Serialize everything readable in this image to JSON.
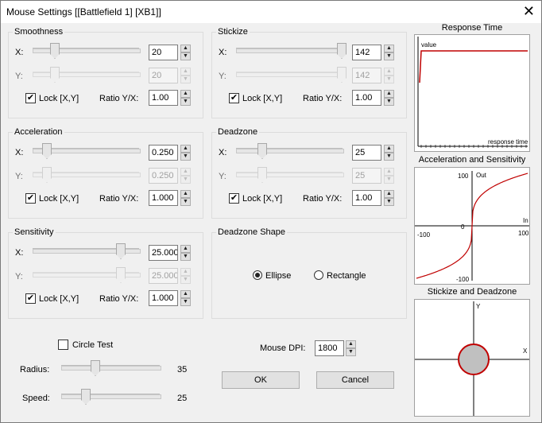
{
  "window": {
    "title": "Mouse Settings [[Battlefield 1] [XB1]]"
  },
  "smoothness": {
    "title": "Smoothness",
    "x_label": "X:",
    "y_label": "Y:",
    "x_value": "20",
    "y_value": "20",
    "lock_label": "Lock [X,Y]",
    "ratio_label": "Ratio Y/X:",
    "ratio_value": "1.00",
    "x_level": 0.25,
    "y_level": 0.25
  },
  "stickize": {
    "title": "Stickize",
    "x_label": "X:",
    "y_label": "Y:",
    "x_value": "142",
    "y_value": "142",
    "lock_label": "Lock [X,Y]",
    "ratio_label": "Ratio Y/X:",
    "ratio_value": "1.00",
    "x_level": 1.0,
    "y_level": 1.0
  },
  "acceleration": {
    "title": "Acceleration",
    "x_label": "X:",
    "y_label": "Y:",
    "x_value": "0.250",
    "y_value": "0.250",
    "lock_label": "Lock [X,Y]",
    "ratio_label": "Ratio Y/X:",
    "ratio_value": "1.000",
    "x_level": 0.1,
    "y_level": 0.1
  },
  "deadzone": {
    "title": "Deadzone",
    "x_label": "X:",
    "y_label": "Y:",
    "x_value": "25",
    "y_value": "25",
    "lock_label": "Lock [X,Y]",
    "ratio_label": "Ratio Y/X:",
    "ratio_value": "1.00",
    "x_level": 0.25,
    "y_level": 0.25
  },
  "sensitivity": {
    "title": "Sensitivity",
    "x_label": "X:",
    "y_label": "Y:",
    "x_value": "25.000",
    "y_value": "25.000",
    "lock_label": "Lock [X,Y]",
    "ratio_label": "Ratio Y/X:",
    "ratio_value": "1.000",
    "x_level": 0.8,
    "y_level": 0.8
  },
  "deadzone_shape": {
    "title": "Deadzone Shape",
    "ellipse_label": "Ellipse",
    "rectangle_label": "Rectangle",
    "selected": "Ellipse"
  },
  "circle_test": {
    "label": "Circle Test",
    "radius_label": "Radius:",
    "radius_value": "35",
    "speed_label": "Speed:",
    "speed_value": "25",
    "radius_level": 0.35,
    "speed_level": 0.25
  },
  "dpi": {
    "label": "Mouse DPI:",
    "value": "1800"
  },
  "buttons": {
    "ok": "OK",
    "cancel": "Cancel"
  },
  "response_time": {
    "title": "Response Time",
    "y_label": "value",
    "x_label": "response time",
    "line_color": "#c00000"
  },
  "accel_sens": {
    "title": "Acceleration and Sensitivity",
    "out_label": "Out",
    "in_label": "In",
    "x_min": "-100",
    "x_max": "100",
    "y_max": "100",
    "y_min": "-100",
    "zero": "0",
    "curve_color": "#c00000"
  },
  "stickize_deadzone": {
    "title": "Stickize and Deadzone",
    "x_label": "X",
    "y_label": "Y",
    "fill_color": "#c0c0c0",
    "ring_color": "#c00000"
  }
}
